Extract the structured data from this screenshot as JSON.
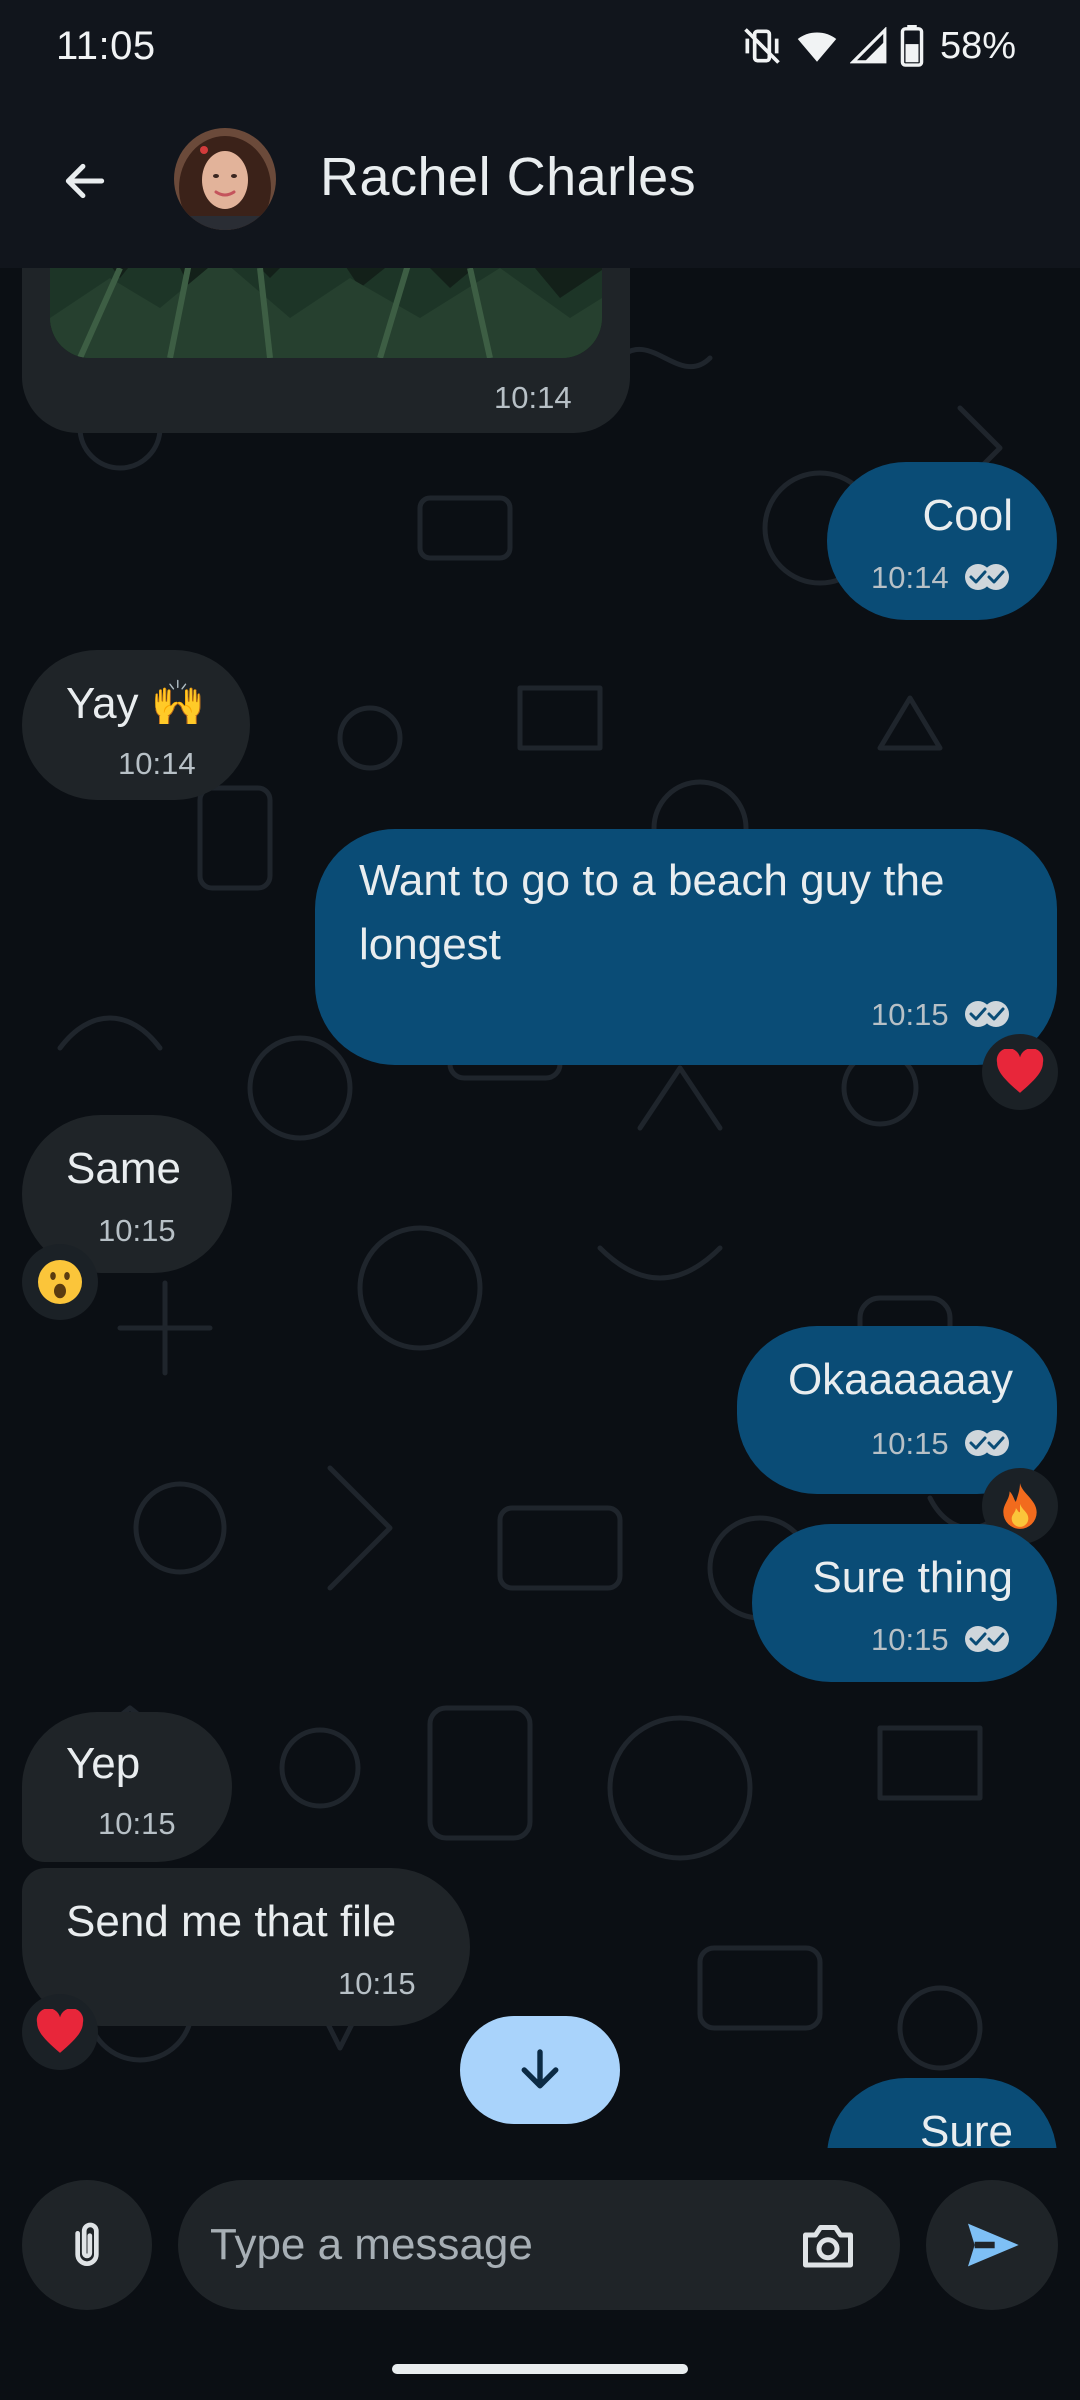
{
  "status_bar": {
    "time": "11:05",
    "battery": "58%",
    "icons": [
      "vibrate-off-icon",
      "wifi-icon",
      "cell-signal-icon",
      "battery-icon"
    ]
  },
  "header": {
    "contact_name": "Rachel Charles",
    "icons": [
      "back-arrow-icon"
    ]
  },
  "messages": [
    {
      "direction": "incoming",
      "type": "image",
      "time": "10:14"
    },
    {
      "direction": "outgoing",
      "text": "Cool",
      "time": "10:14",
      "read": true
    },
    {
      "direction": "incoming",
      "text": "Yay 🙌",
      "time": "10:14"
    },
    {
      "direction": "outgoing",
      "text_lines": [
        "Want to go to a beach guy the",
        "longest"
      ],
      "time": "10:15",
      "read": true,
      "reaction": "❤️"
    },
    {
      "direction": "incoming",
      "text": "Same",
      "time": "10:15",
      "reaction": "😮"
    },
    {
      "direction": "outgoing",
      "text": "Okaaaaaay",
      "time": "10:15",
      "read": true,
      "reaction": "🔥"
    },
    {
      "direction": "outgoing",
      "text": "Sure thing",
      "time": "10:15",
      "read": true
    },
    {
      "direction": "incoming",
      "text": "Yep",
      "time": "10:15"
    },
    {
      "direction": "incoming",
      "text": "Send me that file",
      "time": "10:15",
      "reaction": "❤️"
    },
    {
      "direction": "outgoing",
      "text": "Sure",
      "partial": true
    }
  ],
  "composer": {
    "placeholder": "Type a message",
    "icons": [
      "attach-icon",
      "camera-icon",
      "send-icon"
    ]
  },
  "scroll_button": {
    "icon": "arrow-down-icon"
  },
  "colors": {
    "background": "#0b0f14",
    "header": "#11151c",
    "incoming_bubble": "#1f2428",
    "outgoing_bubble": "#0a4c76",
    "scroll_button": "#a9d3fb"
  }
}
